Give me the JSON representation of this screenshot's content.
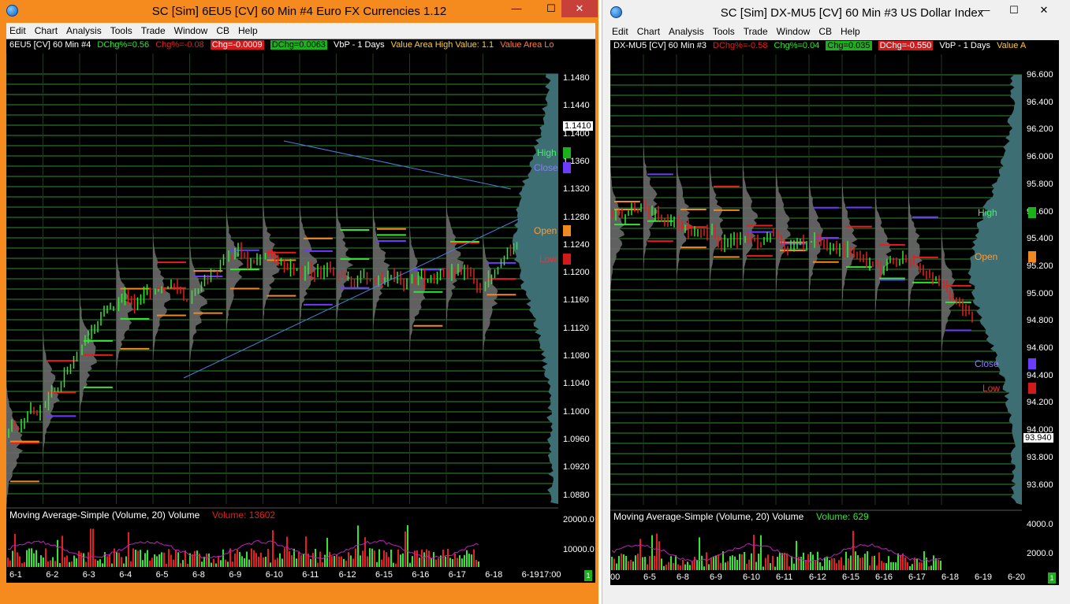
{
  "left": {
    "title": "SC [Sim] 6EU5 [CV]  60 Min   #4  Euro FX Currencies  1.12",
    "menu": [
      "Edit",
      "Chart",
      "Analysis",
      "Tools",
      "Trade",
      "Window",
      "CB",
      "Help"
    ],
    "studies": {
      "symbol": "6EU5 [CV]  60 Min   #4",
      "dchg_pct": "DChg%=0.56",
      "chg_pct": "Chg%=-0.08",
      "chg": "Chg=-0.0009",
      "dchg": "DChg=0.0063",
      "vbp": "VbP - 1 Days",
      "vah": "Value Area High Value: 1.1",
      "val": "Value Area Lo"
    },
    "price_ticks": [
      "1.1480",
      "1.1440",
      "1.1400",
      "1.1360",
      "1.1320",
      "1.1280",
      "1.1240",
      "1.1200",
      "1.1160",
      "1.1120",
      "1.1080",
      "1.1040",
      "1.1000",
      "1.0960",
      "1.0920",
      "1.0880"
    ],
    "last_price": "1.1410",
    "labels": {
      "high": "High",
      "close": "Close",
      "open": "Open",
      "low": "Low"
    },
    "volume_study": {
      "title": "Moving Average-Simple   (Volume, 20)  Volume",
      "value": "Volume: 13602"
    },
    "volume_ticks": [
      "20000.0",
      "10000.0"
    ],
    "dates": [
      "6-1",
      "6-2",
      "6-3",
      "6-4",
      "6-5",
      "6-8",
      "6-9",
      "6-10",
      "6-11",
      "6-12",
      "6-15",
      "6-16",
      "6-17",
      "6-18",
      "6-19"
    ],
    "time_label": "17:00",
    "page_indicator": "1"
  },
  "right": {
    "title": "SC [Sim] DX-MU5 [CV]  60 Min   #3  US Dollar Index",
    "menu": [
      "Edit",
      "Chart",
      "Analysis",
      "Tools",
      "Trade",
      "Window",
      "CB",
      "Help"
    ],
    "studies": {
      "symbol": "DX-MU5 [CV]  60 Min   #3",
      "dchg_pct": "DChg%=-0.58",
      "chg_pct": "Chg%=0.04",
      "chg": "Chg=0.035",
      "dchg": "DChg=-0.550",
      "vbp": "VbP - 1 Days",
      "val": "Value A"
    },
    "price_ticks": [
      "96.600",
      "96.400",
      "96.200",
      "96.000",
      "95.800",
      "95.600",
      "95.400",
      "95.200",
      "95.000",
      "94.800",
      "94.600",
      "94.400",
      "94.200",
      "94.000",
      "93.800",
      "93.600"
    ],
    "last_price": "93.940",
    "labels": {
      "high": "High",
      "open": "Open",
      "close": "Close",
      "low": "Low"
    },
    "volume_study": {
      "title": "Moving Average-Simple   (Volume, 20)  Volume",
      "value": "Volume: 629"
    },
    "volume_ticks": [
      "4000.0",
      "2000.0"
    ],
    "dates": [
      "00",
      "6-5",
      "6-8",
      "6-9",
      "6-10",
      "6-11",
      "6-12",
      "6-15",
      "6-16",
      "6-17",
      "6-18",
      "6-19",
      "6-20"
    ],
    "page_indicator": "1"
  },
  "colors": {
    "active_frame": "#f58a1f",
    "up_bar": "#32e632",
    "down_bar": "#e61e1e",
    "grid_green": "#2d8f2d",
    "profile_teal": "#3d6e74",
    "trendline": "#4a7fd8",
    "ma_line": "#c020c0"
  }
}
